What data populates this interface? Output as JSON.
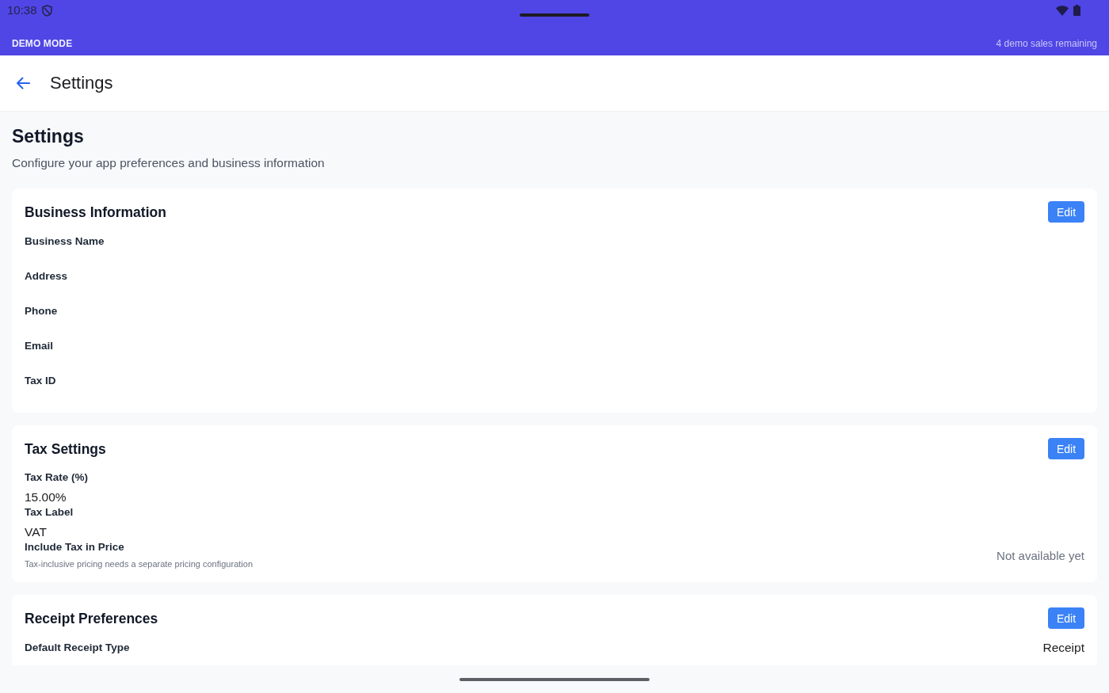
{
  "status_bar": {
    "time": "10:38"
  },
  "demo_banner": {
    "label": "DEMO MODE",
    "remaining": "4 demo sales remaining"
  },
  "app_bar": {
    "title": "Settings"
  },
  "page": {
    "heading": "Settings",
    "subtitle": "Configure your app preferences and business information"
  },
  "sections": [
    {
      "title": "Business Information",
      "edit_label": "Edit",
      "fields": [
        {
          "kind": "empty",
          "label": "Business Name"
        },
        {
          "kind": "empty",
          "label": "Address"
        },
        {
          "kind": "empty",
          "label": "Phone"
        },
        {
          "kind": "empty",
          "label": "Email"
        },
        {
          "kind": "empty",
          "label": "Tax ID"
        }
      ]
    },
    {
      "title": "Tax Settings",
      "edit_label": "Edit",
      "fields": [
        {
          "kind": "stacked",
          "label": "Tax Rate (%)",
          "value": "15.00%"
        },
        {
          "kind": "stacked",
          "label": "Tax Label",
          "value": "VAT"
        },
        {
          "kind": "note",
          "label": "Include Tax in Price",
          "hint": "Tax-inclusive pricing needs a separate pricing configuration",
          "status": "Not available yet"
        }
      ]
    },
    {
      "title": "Receipt Preferences",
      "edit_label": "Edit",
      "fields": [
        {
          "kind": "inline",
          "label": "Default Receipt Type",
          "value": "Receipt"
        }
      ]
    }
  ]
}
